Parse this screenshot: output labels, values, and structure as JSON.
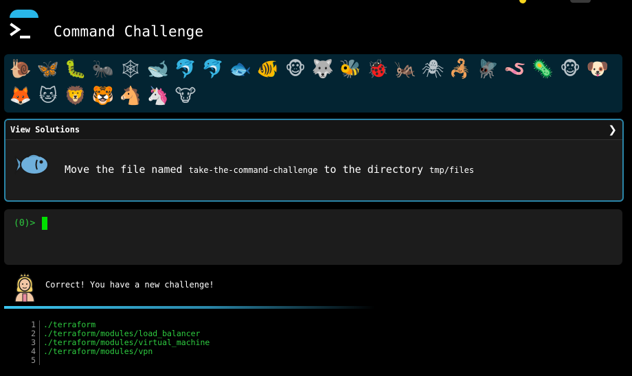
{
  "app": {
    "title": "Command Challenge"
  },
  "animals": {
    "row1": [
      "🐌",
      "🦋",
      "🐛",
      "🐜",
      "🕸",
      "🐋",
      "🐬",
      "🐬",
      "🐟",
      "🐠",
      "🐵",
      "🐺",
      "🐝",
      "🐞",
      "🦗",
      "🕷",
      "🦂",
      "🪰",
      "🪱",
      "🦠",
      "🐵",
      "🐶"
    ],
    "row2": [
      "🦊",
      "🐱",
      "🦁",
      "🐯",
      "🐴",
      "🦄",
      "🐮"
    ],
    "current_index": 8
  },
  "panel": {
    "solutions_label": "View Solutions",
    "challenge_prefix": "Move the file named ",
    "challenge_file": "take-the-command-challenge",
    "challenge_middle": " to the directory ",
    "challenge_dir": "tmp/files"
  },
  "terminal": {
    "prompt": "(0)>"
  },
  "status": {
    "message": "Correct! You have a new challenge!"
  },
  "output": {
    "lines": [
      {
        "n": "1",
        "text": "./terraform"
      },
      {
        "n": "2",
        "text": "./terraform/modules/load_balancer"
      },
      {
        "n": "3",
        "text": "./terraform/modules/virtual_machine"
      },
      {
        "n": "4",
        "text": "./terraform/modules/vpn"
      },
      {
        "n": "5",
        "text": ""
      }
    ]
  },
  "colors": {
    "accent": "#29b6e8",
    "panel_border": "#2a85a8",
    "animal_bar_bg": "#032432",
    "terminal_green": "#2ecc40"
  }
}
